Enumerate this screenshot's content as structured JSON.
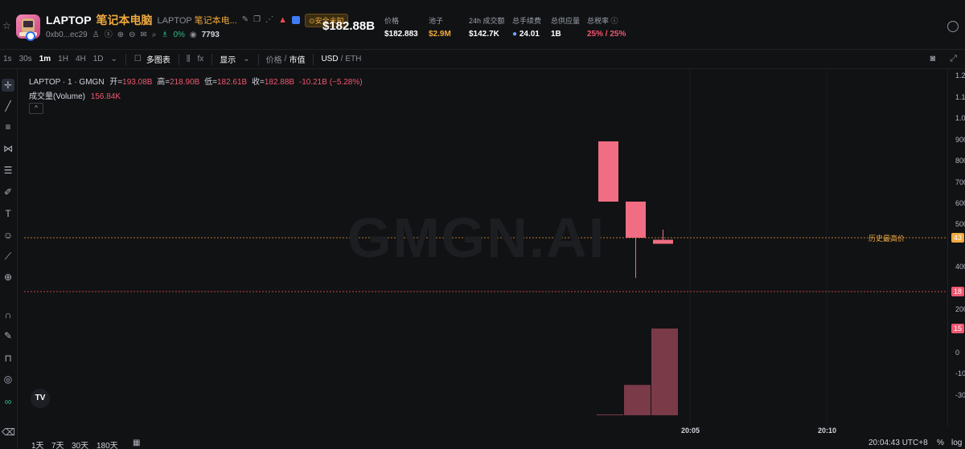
{
  "token": {
    "symbol": "LAPTOP",
    "name_cn": "笔记本电脑",
    "full_name_prefix": "LAPTOP",
    "full_name_cn": "笔记本电...",
    "safety_badge": "⊙安全未知",
    "address": "0xb0...ec29",
    "green_pct": "0%",
    "views": "7793",
    "price_big": "$182.88B"
  },
  "stats": [
    {
      "label": "价格",
      "value": "$182.883",
      "tone": "white"
    },
    {
      "label": "池子",
      "value": "$2.9M",
      "tone": "orange"
    },
    {
      "label": "24h 成交额",
      "value": "$142.7K",
      "tone": "white"
    },
    {
      "label": "总手续费",
      "value": "24.01",
      "tone": "white"
    },
    {
      "label": "总供应量",
      "value": "1B",
      "tone": "white"
    },
    {
      "label": "总税率 ⓘ",
      "value": "25% / 25%",
      "tone": "pink"
    }
  ],
  "toolbar": {
    "intervals": [
      "1s",
      "30s",
      "1m",
      "1H",
      "4H",
      "1D"
    ],
    "active_interval": "1m",
    "multi_chart": "多图表",
    "indicator_icon": "fx",
    "display": "显示",
    "price_label": "价格",
    "mcap_label": "市值",
    "usd_label": "USD",
    "eth_label": "ETH"
  },
  "chart_legend": {
    "pair": "LAPTOP · 1 · GMGN",
    "open_label": "开=",
    "open": "193.08B",
    "high_label": "高=",
    "high": "218.90B",
    "low_label": "低=",
    "low": "182.61B",
    "close_label": "收=",
    "close": "182.88B",
    "change": "-10.21B (−5.28%)",
    "volume_label": "成交量(Volume)",
    "volume": "156.84K",
    "ath_label": "历史最高价",
    "watermark": "GMGN.AI"
  },
  "yaxis": {
    "ticks": [
      "1.2",
      "1.1",
      "1.0",
      "900",
      "800",
      "700",
      "600",
      "500",
      "400",
      "300",
      "200",
      "100",
      "0",
      "-10",
      "-20",
      "-30"
    ],
    "tags": [
      {
        "text": "43",
        "color": "#f0a93d"
      },
      {
        "text": "18",
        "color": "#f0566f"
      },
      {
        "text": "15",
        "color": "#f0566f"
      }
    ]
  },
  "xaxis": {
    "ticks": [
      "20:05",
      "20:10"
    ]
  },
  "bottom": {
    "ranges": [
      "1天",
      "7天",
      "30天",
      "180天"
    ],
    "time": "20:04:43 UTC+8",
    "pct": "%",
    "log": "log"
  },
  "chart_data": {
    "type": "candlestick",
    "candles": [
      {
        "open_rel": 0.44,
        "close_rel": 0.29,
        "high_rel": 0.44,
        "low_rel": 0.29
      },
      {
        "open_rel": 0.29,
        "close_rel": 0.2,
        "high_rel": 0.29,
        "low_rel": 0.1
      },
      {
        "open_rel": 0.195,
        "close_rel": 0.185,
        "high_rel": 0.22,
        "low_rel": 0.185
      }
    ],
    "volume_rel": [
      0.0,
      0.35,
      1.0
    ]
  }
}
